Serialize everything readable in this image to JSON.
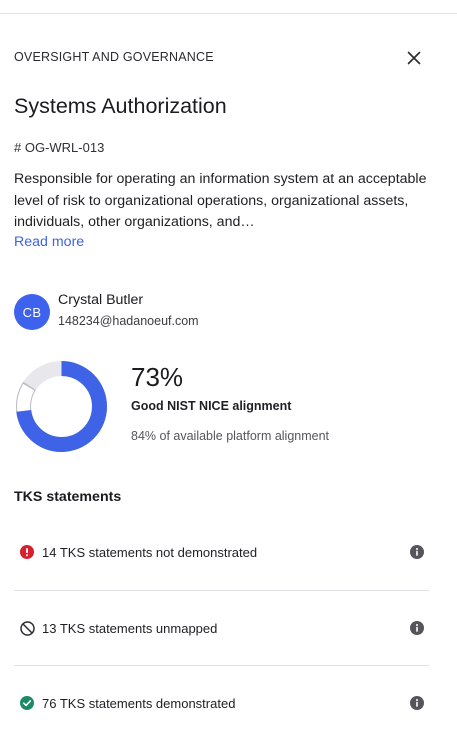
{
  "panel": {
    "category": "OVERSIGHT AND GOVERNANCE",
    "title": "Systems Authorization",
    "code": "# OG-WRL-013",
    "description": "Responsible for operating an information system at an acceptable level of risk to organizational operations, organizational assets, individuals, other organizations, and…",
    "read_more": "Read more"
  },
  "user": {
    "initials": "CB",
    "name": "Crystal Butler",
    "email": "148234@hadanoeuf.com"
  },
  "alignment": {
    "percent_text": "73%",
    "percent_value": 73,
    "platform_value": 84,
    "label": "Good NIST NICE alignment",
    "sub": "84% of available platform alignment"
  },
  "tks": {
    "section_title": "TKS statements",
    "items": [
      {
        "label": "14 TKS statements not demonstrated",
        "icon": "error-icon",
        "color": "#d6202d"
      },
      {
        "label": "13 TKS statements unmapped",
        "icon": "unmapped-icon",
        "color": "#2b2b30"
      },
      {
        "label": "76 TKS statements demonstrated",
        "icon": "check-circle-icon",
        "color": "#1a8a67"
      }
    ]
  },
  "colors": {
    "accent": "#3f63e6",
    "donut_track": "#e7e7ec"
  }
}
